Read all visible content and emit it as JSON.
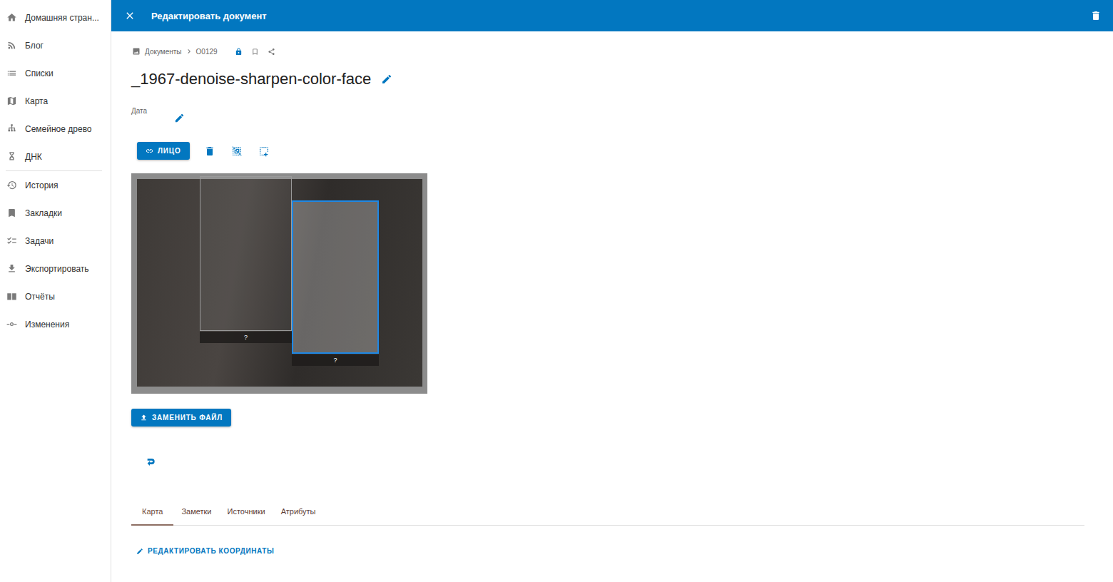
{
  "sidebar": {
    "groups": [
      [
        {
          "label": "Домашняя стран...",
          "selected": false
        },
        {
          "label": "Блог",
          "selected": false
        },
        {
          "label": "Списки",
          "selected": false
        },
        {
          "label": "Карта",
          "selected": false
        },
        {
          "label": "Семейное древо",
          "selected": false
        },
        {
          "label": "ДНК",
          "selected": false
        }
      ],
      [
        {
          "label": "История",
          "selected": false
        },
        {
          "label": "Закладки",
          "selected": false
        },
        {
          "label": "Задачи",
          "selected": false
        },
        {
          "label": "Экспортировать",
          "selected": false
        },
        {
          "label": "Отчёты",
          "selected": false
        },
        {
          "label": "Изменения",
          "selected": false
        }
      ]
    ]
  },
  "dialog": {
    "title": "Редактировать документ"
  },
  "breadcrumb": {
    "items": [
      "Документы",
      "O0129"
    ]
  },
  "document": {
    "title": "_1967-denoise-sharpen-color-face",
    "date_label": "Дата"
  },
  "toolbar": {
    "face_button": "ЛИЦО"
  },
  "faces": [
    {
      "label": "?",
      "selected": false
    },
    {
      "label": "?",
      "selected": true
    }
  ],
  "replace_button": "ЗАМЕНИТЬ ФАЙЛ",
  "tabs": [
    {
      "label": "Карта",
      "selected": true
    },
    {
      "label": "Заметки",
      "selected": false
    },
    {
      "label": "Источники",
      "selected": false
    },
    {
      "label": "Атрибуты",
      "selected": false
    }
  ],
  "map": {
    "edit_link": "РЕДАКТИРОВАТЬ КООРДИНАТЫ"
  }
}
